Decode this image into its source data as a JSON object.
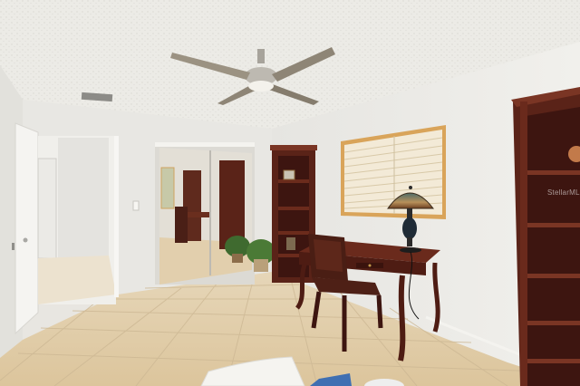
{
  "scene": {
    "description_kind": "interior-photo",
    "palette": {
      "ceiling": "#ecebe6",
      "wall": "#e9e8e4",
      "floor": "#e3cfae",
      "grout": "#c9b596",
      "wood": "#5a2318",
      "wood_light": "#7a3524",
      "blind": "#f3ead7",
      "window_frame": "#d9a45a"
    }
  },
  "watermark": {
    "text": "StellarMLS"
  }
}
